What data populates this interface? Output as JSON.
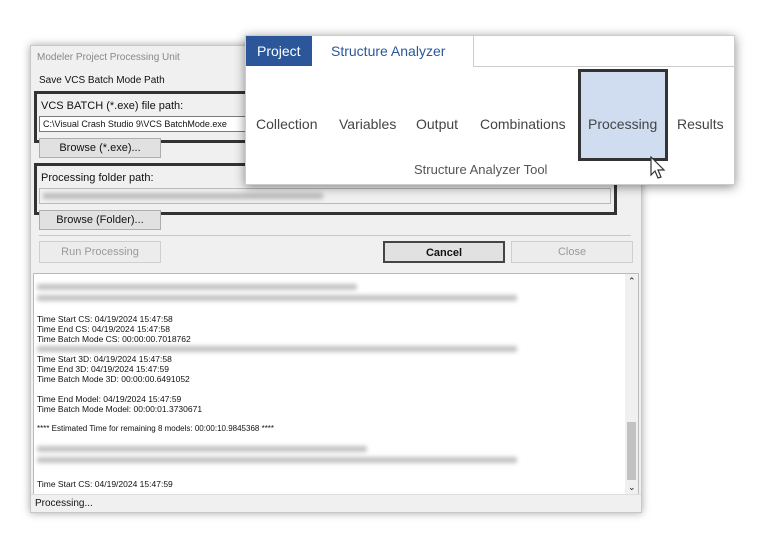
{
  "window": {
    "title": "Modeler Project Processing Unit",
    "menu": "Save VCS Batch Mode Path"
  },
  "exe": {
    "label": "VCS BATCH (*.exe) file path:",
    "value": "C:\\Visual Crash Studio 9\\VCS BatchMode.exe",
    "browse": "Browse (*.exe)..."
  },
  "folder": {
    "label": "Processing folder path:",
    "browse": "Browse (Folder)..."
  },
  "buttons": {
    "run": "Run Processing",
    "cancel": "Cancel",
    "close": "Close"
  },
  "log": {
    "lines": [
      "Time Start CS: 04/19/2024 15:47:58",
      "Time End CS: 04/19/2024 15:47:58",
      "Time Batch Mode CS: 00:00:00.7018762",
      "Time Start 3D: 04/19/2024 15:47:58",
      "Time End 3D: 04/19/2024 15:47:59",
      "Time Batch Mode 3D: 00:00:00.6491052",
      "Time End Model: 04/19/2024 15:47:59",
      "Time Batch Mode Model: 00:00:01.3730671",
      "**** Estimated Time for remaining 8 models: 00:00:10.9845368 ****",
      "Time Start CS: 04/19/2024 15:47:59"
    ]
  },
  "status": "Processing...",
  "ribbon": {
    "tabs": [
      "Project",
      "Structure Analyzer"
    ],
    "buttons": [
      "Collection",
      "Variables",
      "Output",
      "Combinations",
      "Processing",
      "Results"
    ],
    "group": "Structure Analyzer Tool",
    "active_tab_color": "#2b579a",
    "selected_color": "#d0dcef"
  }
}
